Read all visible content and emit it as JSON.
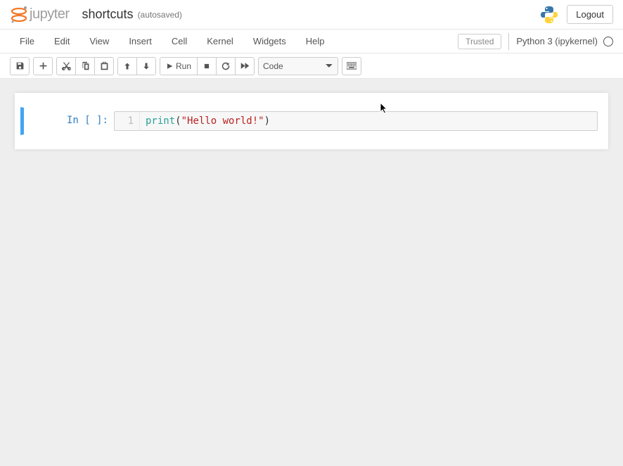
{
  "header": {
    "logo_text": "Jupyter",
    "title": "shortcuts",
    "autosave": "(autosaved)",
    "logout": "Logout"
  },
  "menubar": {
    "items": [
      "File",
      "Edit",
      "View",
      "Insert",
      "Cell",
      "Kernel",
      "Widgets",
      "Help"
    ],
    "trusted": "Trusted",
    "kernel": "Python 3 (ipykernel)"
  },
  "toolbar": {
    "run": "Run",
    "cell_type": "Code"
  },
  "cell": {
    "prompt": "In [ ]:",
    "line_number": "1",
    "code": {
      "func": "print",
      "open": "(",
      "str": "\"Hello world!\"",
      "close": ")"
    }
  }
}
